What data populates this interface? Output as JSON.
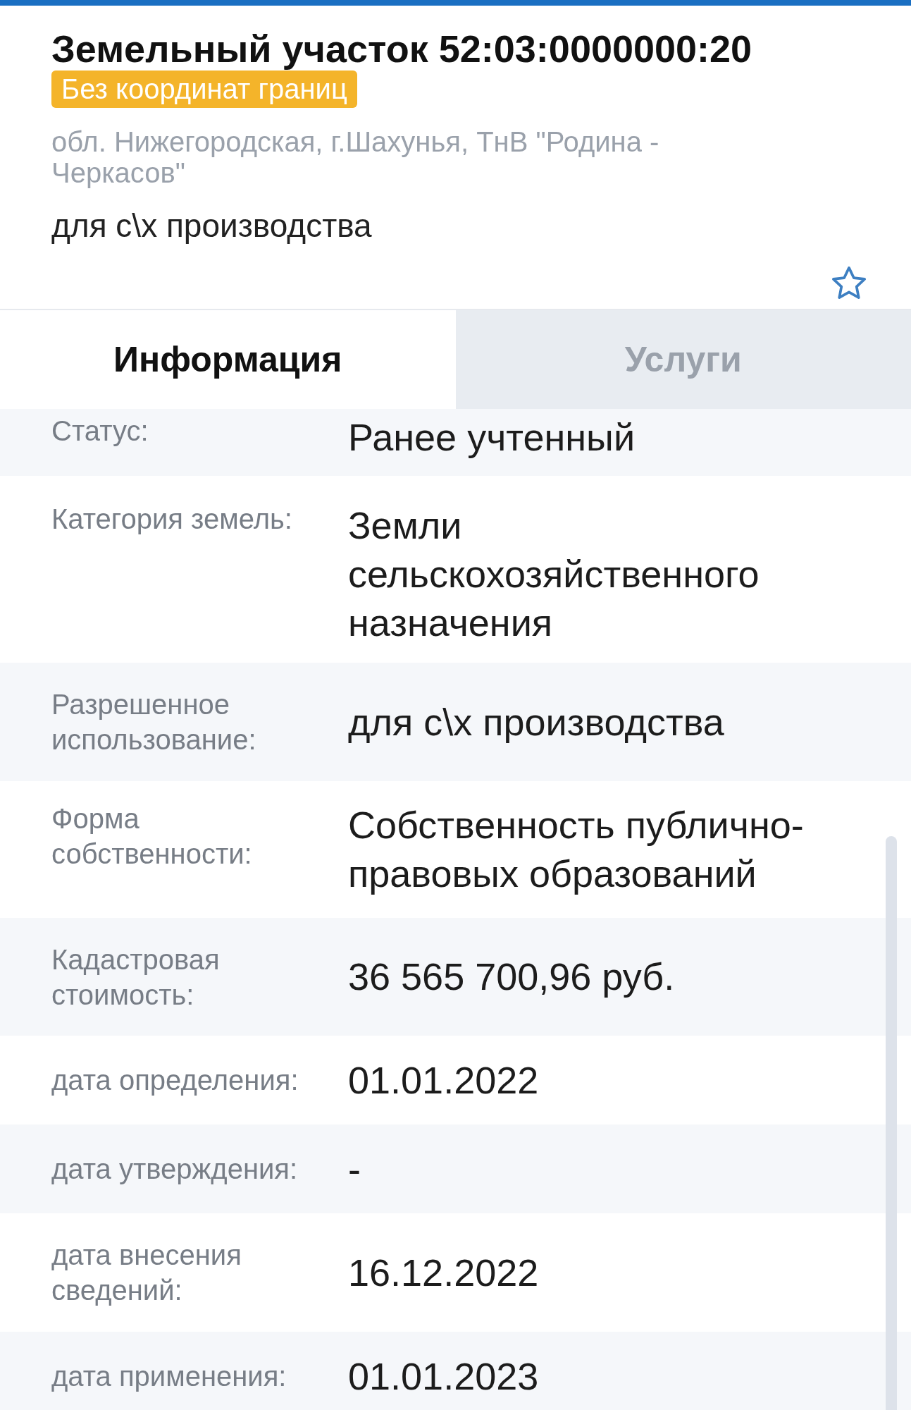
{
  "header": {
    "title": "Земельный участок 52:03:0000000:20",
    "badge": "Без координат границ",
    "address": "обл. Нижегородская, г.Шахунья, ТнВ \"Родина - Черкасов\"",
    "purpose": "для с\\х производства"
  },
  "tabs": [
    {
      "label": "Информация",
      "selected": true
    },
    {
      "label": "Услуги",
      "selected": false
    }
  ],
  "rows": [
    {
      "label": "Статус:",
      "value": "Ранее учтенный"
    },
    {
      "label": "Категория земель:",
      "value": "Земли сельскохозяйственного назначения"
    },
    {
      "label": "Разрешенное использование:",
      "value": "для с\\х производства"
    },
    {
      "label": "Форма собственности:",
      "value": "Собственность публично-правовых образований"
    },
    {
      "label": "Кадастровая стоимость:",
      "value": "36 565 700,96 руб."
    },
    {
      "label": "дата определения:",
      "value": "01.01.2022"
    },
    {
      "label": "дата утверждения:",
      "value": "-"
    },
    {
      "label": "дата внесения сведений:",
      "value": "16.12.2022"
    },
    {
      "label": "дата применения:",
      "value": "01.01.2023"
    }
  ]
}
